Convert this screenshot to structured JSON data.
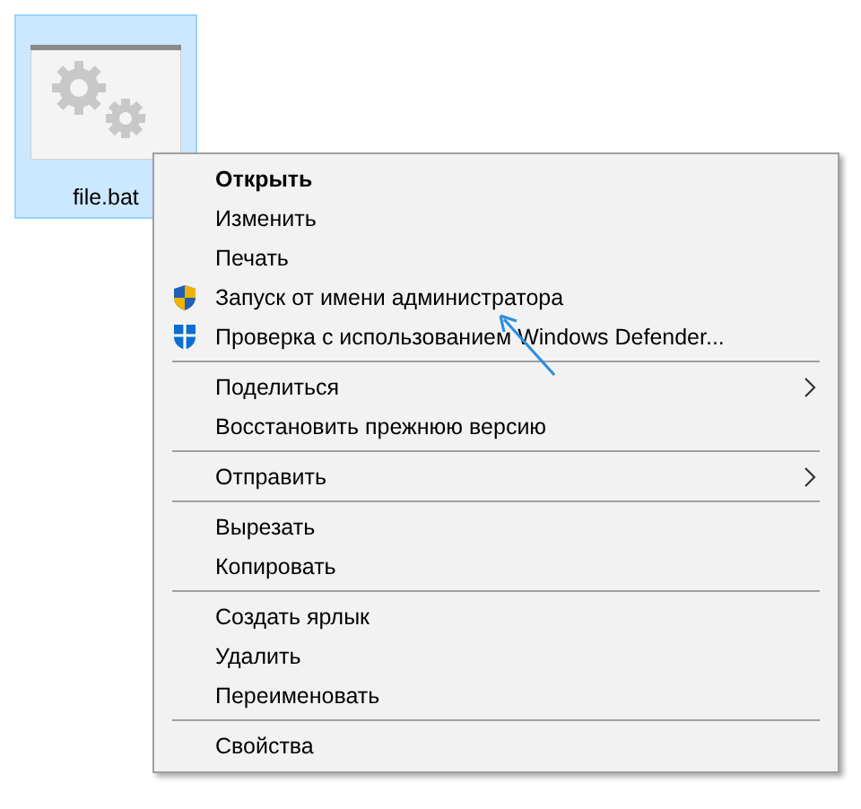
{
  "desktop_icon": {
    "label": "file.bat",
    "selected": true
  },
  "context_menu": {
    "groups": [
      [
        {
          "label": "Открыть",
          "bold": true
        },
        {
          "label": "Изменить",
          "bold": false
        },
        {
          "label": "Печать",
          "bold": false
        },
        {
          "label": "Запуск от имени администратора",
          "bold": false,
          "kind": "elevated"
        },
        {
          "label": "Проверка с использованием Windows Defender...",
          "bold": false,
          "kind": "scan"
        }
      ],
      [
        {
          "label": "Поделиться",
          "bold": false,
          "submenu": true
        },
        {
          "label": "Восстановить прежнюю версию",
          "bold": false
        }
      ],
      [
        {
          "label": "Отправить",
          "bold": false,
          "submenu": true
        }
      ],
      [
        {
          "label": "Вырезать",
          "bold": false
        },
        {
          "label": "Копировать",
          "bold": false
        }
      ],
      [
        {
          "label": "Создать ярлык",
          "bold": false
        },
        {
          "label": "Удалить",
          "bold": false
        },
        {
          "label": "Переименовать",
          "bold": false
        }
      ],
      [
        {
          "label": "Свойства",
          "bold": false
        }
      ]
    ]
  }
}
